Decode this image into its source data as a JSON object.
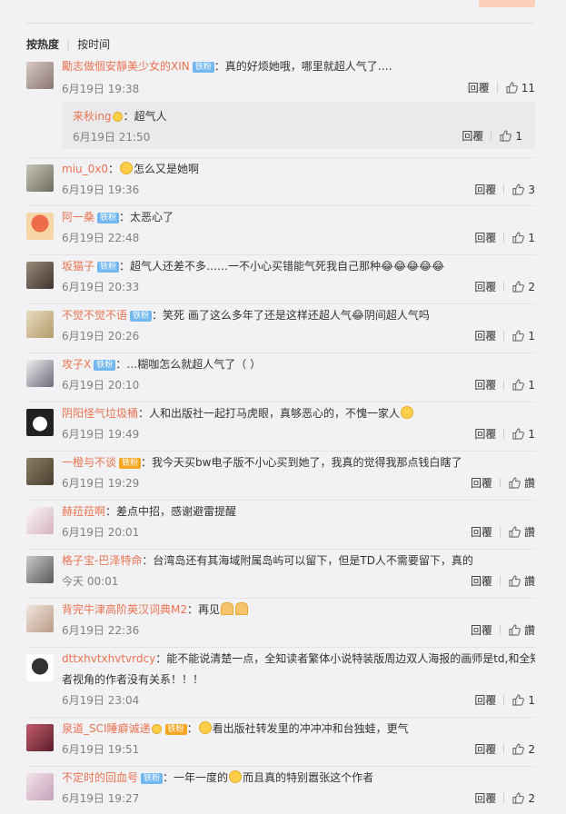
{
  "sort": {
    "hot": "按热度",
    "time": "按时间"
  },
  "labels": {
    "reply": "回覆",
    "badge_iron": "铁粉"
  },
  "colors": {
    "name": "#eb7350",
    "badge": "#72b7f0",
    "bg": "#f2f2f5"
  },
  "comments": [
    {
      "name": "勵志做個安靜美少女的XIN",
      "badge": "铁粉",
      "text": "真的好烦她哦，哪里就超人气了….",
      "time": "6月19日 19:38",
      "likes": "11",
      "sub": {
        "name": "来秋ing",
        "text": "超气人",
        "time": "6月19日 21:50",
        "likes": "1"
      }
    },
    {
      "name": "miu_0x0",
      "badge": "",
      "text": "怎么又是她啊",
      "time": "6月19日 19:36",
      "likes": "3"
    },
    {
      "name": "阿一桑",
      "badge": "铁粉",
      "text": "太恶心了",
      "time": "6月19日 22:48",
      "likes": "1"
    },
    {
      "name": "坂猫子",
      "badge": "铁粉",
      "text": "超气人还差不多……一不小心买错能气死我自己那种😂😂😂😂😂",
      "time": "6月19日 20:33",
      "likes": "2"
    },
    {
      "name": "不觉不觉不语",
      "badge": "铁粉",
      "text": "笑死 画了这么多年了还是这样还超人气😂阴间超人气吗",
      "time": "6月19日 20:26",
      "likes": "1"
    },
    {
      "name": "攻子X",
      "badge": "铁粉",
      "text": "…糊咖怎么就超人气了（ ）",
      "time": "6月19日 20:10",
      "likes": "1"
    },
    {
      "name": "阴阳怪气垃圾桶",
      "badge": "",
      "text": "人和出版社一起打马虎眼，真够恶心的，不愧一家人",
      "time": "6月19日 19:49",
      "likes": "1"
    },
    {
      "name": "一橙与不谈",
      "badge": "铁粉",
      "text": "我今天买bw电子版不小心买到她了，我真的觉得我那点钱白瞎了",
      "time": "6月19日 19:29",
      "likes": "讚"
    },
    {
      "name": "赫菈菈啊",
      "badge": "",
      "text": "差点中招，感谢避雷提醒",
      "time": "6月19日 20:01",
      "likes": "讚"
    },
    {
      "name": "格子宝-巴泽特命",
      "badge": "",
      "text": "台湾岛还有其海域附属岛屿可以留下，但是TD人不需要留下，真的",
      "time": "今天 00:01",
      "likes": "讚"
    },
    {
      "name": "背完牛津高阶英汉词典M2",
      "badge": "",
      "text": "再见",
      "time": "6月19日 22:36",
      "likes": "讚"
    },
    {
      "name": "dttxhvtxhvtvrdcy",
      "badge": "",
      "text": "能不能说清楚一点，全知读者繁体小说特装版周边双人海报的画师是td,和全知读",
      "text2": "者视角的作者没有关系！！！",
      "time": "6月19日 23:04",
      "likes": "1"
    },
    {
      "name": "泉道_SCI睡癖诚递",
      "badge": "铁粉",
      "text": "看出版社转发里的冲冲冲和台独蛙，更气",
      "time": "6月19日 19:51",
      "likes": "2"
    },
    {
      "name": "不定时的回血号",
      "badge": "铁粉",
      "text": "一年一度的",
      "text_b": "而且真的特别嚣张这个作者",
      "time": "6月19日 19:27",
      "likes": "2"
    }
  ]
}
